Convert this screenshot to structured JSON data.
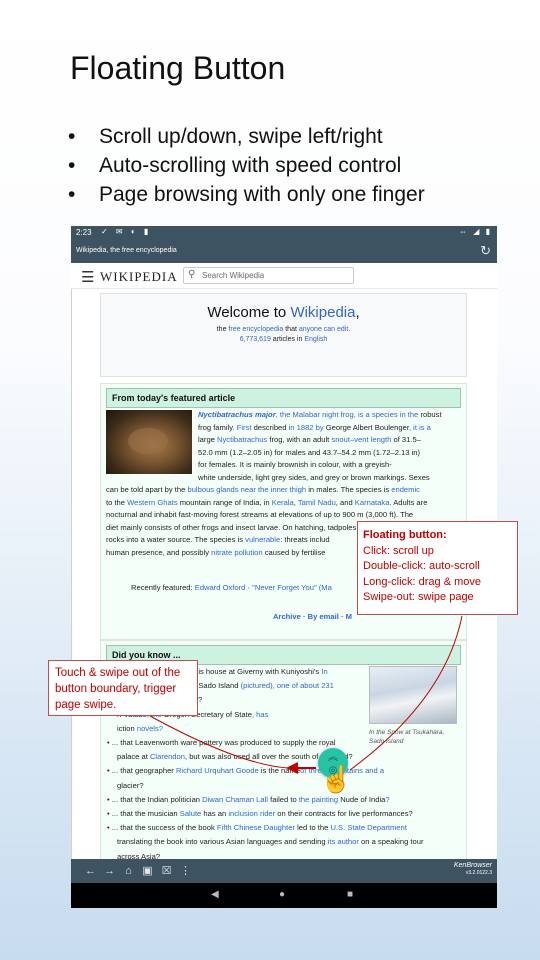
{
  "slide": {
    "title": "Floating Button",
    "bullets": [
      "Scroll up/down, swipe left/right",
      "Auto-scrolling with speed control",
      "Page browsing with only one finger"
    ]
  },
  "status_bar": {
    "time": "2:23"
  },
  "url_bar": {
    "url": "Wikipedia, the free encyclopedia"
  },
  "wiki": {
    "logo": "WIKIPEDIA",
    "search_placeholder": "Search Wikipedia",
    "welcome": {
      "pre": "Welcome to ",
      "link": "Wikipedia",
      "post": ",",
      "line2_a": "the ",
      "line2_link1": "free encyclopedia",
      "line2_b": " that ",
      "line2_link2": "anyone can edit",
      "line2_c": ".",
      "count": "6,773,619",
      "line3_b": " articles in ",
      "lang": "English"
    },
    "featured": {
      "heading": "From today's featured article",
      "lines": [
        [
          "Nyctibatrachus major",
          ", the Malabar night frog, is a species in the ",
          "robust"
        ],
        [
          "frog family",
          ". First ",
          "described",
          " in 1882 by ",
          "George Albert Boulenger",
          ", it is a"
        ],
        [
          "large ",
          "Nyctibatrachus",
          " frog, with an adult ",
          "snout–vent length",
          " of 31.5–"
        ],
        [
          "52.0 mm (1.2–2.05 in) for males and 43.7–54.2 mm (1.72–2.13 in)"
        ],
        [
          "for females. It is mainly brownish in colour, with a greyish-"
        ],
        [
          "white underside, light grey sides, and grey or brown markings. Sexes"
        ],
        [
          "can be told apart by the ",
          "bulbous glands near the inner thigh",
          " in males. The species is ",
          "endemic"
        ],
        [
          "to the ",
          "Western Ghats",
          " mountain range of India, in ",
          "Kerala",
          ", ",
          "Tamil Nadu",
          ", and ",
          "Karnataka",
          ". Adults are"
        ],
        [
          "nocturnal and inhabit fast-moving forest streams at elevations of up to 900 m (3,000 ft). The"
        ],
        [
          "diet mainly consists of other frogs and insect larvae. On hatching, tadpoles drop from leaves or"
        ],
        [
          "rocks into a water source. The species is ",
          "vulnerable",
          ": threats includ"
        ],
        [
          "human presence, and possibly ",
          "nitrate pollution",
          " caused by fertilise"
        ]
      ],
      "recent_label": "Recently featured: ",
      "recent_1": "Edward Oxford",
      "recent_sep": " · ",
      "recent_2": "\"Never Forget You\" (Ma",
      "archive": "Archive · By email · M"
    },
    "dyk": {
      "heading": "Did you know ...",
      "items": [
        [
          "... that Monet decorated his house at Giverny with Kuniyoshi's ",
          "In"
        ],
        [
          "the Snow at Tsukahara, Sado Island",
          " (pictured), one of about 231"
        ],
        [
          "netʼs personal collection?"
        ],
        [
          "n-Valade",
          ", the ",
          "Oregon Secretary of State",
          ", has"
        ],
        [
          "iction",
          " novels?"
        ],
        [
          "... that Leavenworth ware pottery was produced to supply the royal"
        ],
        [
          "palace at ",
          "Clarendon",
          ", but was also used all over the south of England?"
        ],
        [
          "... that geographer ",
          "Richard Urquhart Goode",
          " is the name",
          "of three mountains and a"
        ],
        [
          "glacier?"
        ],
        [
          "... that the Indian politician ",
          "Diwan Chaman Lall",
          " failed to ",
          " the painting ",
          "Nude of India",
          "?"
        ],
        [
          "... that the musician ",
          "Salute",
          " has an ",
          "inclusion rider",
          " on their contracts for live performances?"
        ],
        [
          "... that the success of the book ",
          "Fifth Chinese Daughter",
          " led to the ",
          "U.S. State Department"
        ],
        [
          "translating the book into various Asian languages and sending ",
          "its author",
          " on a speaking tour"
        ],
        [
          "across Asia?"
        ]
      ],
      "caption": "In the Snow at Tsukahara, Sado Island"
    }
  },
  "bottom_bar": {
    "app_name": "KenBrowser",
    "version": "v3.2.0122.3"
  },
  "callouts": {
    "swipe": "Touch & swipe out of the button boundary, trigger page swipe.",
    "fab_title": "Floating button:",
    "fab_lines": [
      "Click: scroll up",
      "Double-click: auto-scroll",
      "Long-click: drag & move",
      "Swipe-out: swipe page"
    ]
  },
  "colors": {
    "accent": "#3d5361",
    "link": "#3366cc",
    "callout": "#c00000",
    "fab": "#27c3a7"
  }
}
